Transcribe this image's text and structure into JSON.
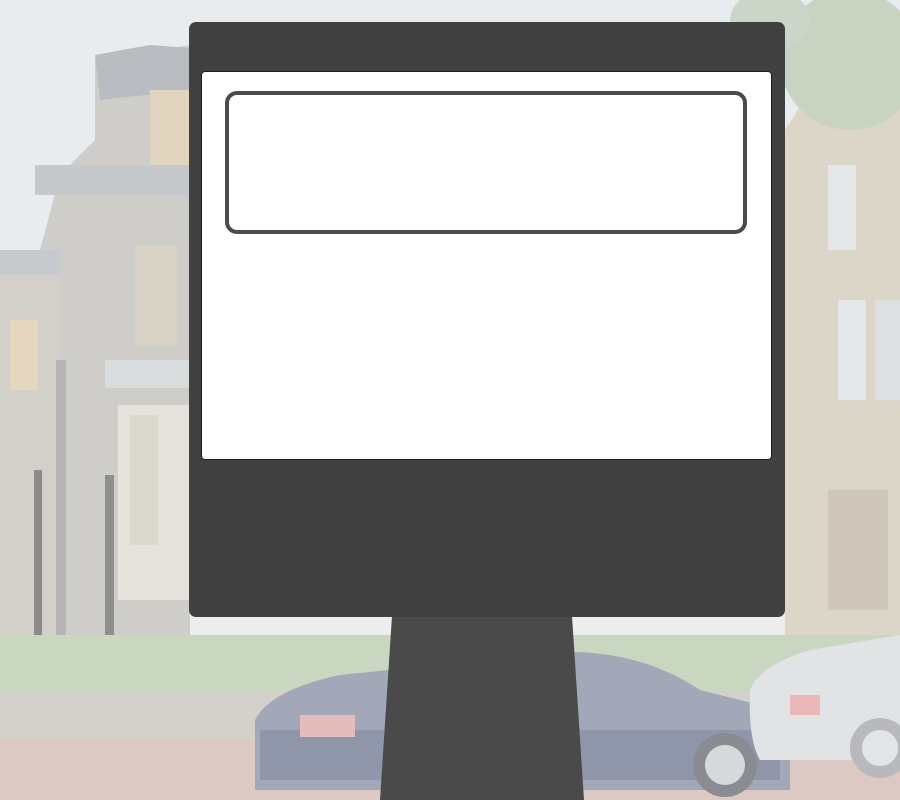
{
  "scene": {
    "description_colors": {
      "frame": "#414141",
      "screen": "#ffffff",
      "textbox_border": "#4b4b4b",
      "post": "#4a4a4a"
    }
  },
  "kiosk": {
    "screen": {
      "textbox_value": ""
    }
  }
}
